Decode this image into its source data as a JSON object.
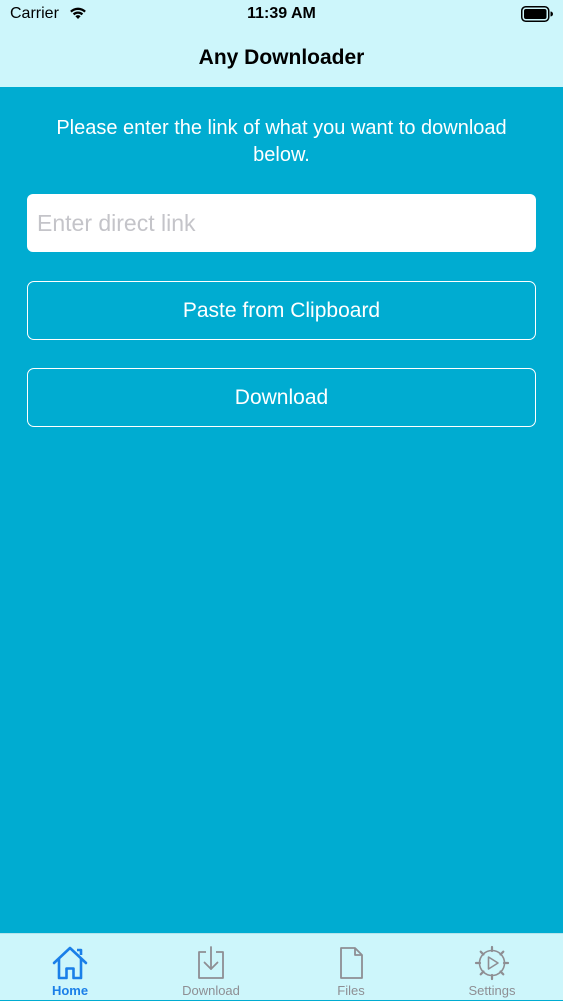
{
  "status_bar": {
    "carrier": "Carrier",
    "time": "11:39 AM"
  },
  "nav": {
    "title": "Any Downloader"
  },
  "main": {
    "instruction": "Please enter the link of what you want to download below.",
    "link_input": {
      "value": "",
      "placeholder": "Enter direct link"
    },
    "paste_label": "Paste from Clipboard",
    "download_label": "Download"
  },
  "tabs": [
    {
      "label": "Home",
      "icon": "home-icon",
      "active": true
    },
    {
      "label": "Download",
      "icon": "download-icon",
      "active": false
    },
    {
      "label": "Files",
      "icon": "file-icon",
      "active": false
    },
    {
      "label": "Settings",
      "icon": "gear-icon",
      "active": false
    }
  ],
  "colors": {
    "bars": "#cdf6fb",
    "content_background": "#00acd1",
    "active_tab": "#1a7fe8",
    "inactive_tab": "#8e8e93"
  }
}
